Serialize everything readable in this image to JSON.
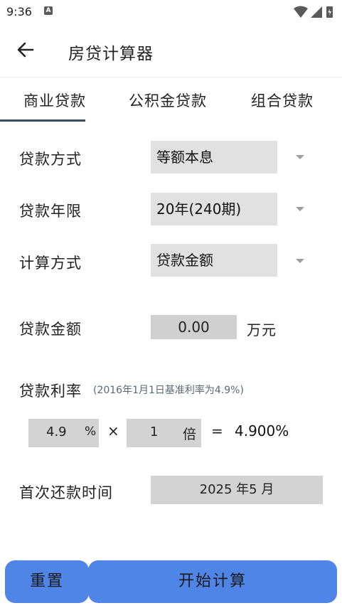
{
  "status_bar": {
    "time": "9:36",
    "notification_badge": "A"
  },
  "app_bar": {
    "title": "房贷计算器"
  },
  "tabs": [
    {
      "label": "商业贷款",
      "selected": true
    },
    {
      "label": "公积金贷款",
      "selected": false
    },
    {
      "label": "组合贷款",
      "selected": false
    }
  ],
  "form": {
    "loan_method": {
      "label": "贷款方式",
      "value": "等额本息"
    },
    "loan_term": {
      "label": "贷款年限",
      "value": "20年(240期)"
    },
    "calc_method": {
      "label": "计算方式",
      "value": "贷款金额"
    },
    "loan_amount": {
      "label": "贷款金额",
      "value": "0.00",
      "unit": "万元"
    },
    "loan_rate": {
      "label": "贷款利率",
      "note": "(2016年1月1日基准利率为4.9%)",
      "base_value": "4.9",
      "base_unit": "%",
      "multiply_sign": "×",
      "multiplier_value": "1",
      "multiplier_unit": "倍",
      "equals_sign": "=",
      "result": "4.900%"
    },
    "first_payment": {
      "label": "首次还款时间",
      "value": "2025 年5 月"
    }
  },
  "buttons": {
    "reset_label": "重置",
    "calculate_label": "开始计算"
  },
  "colors": {
    "accent": "#5085e8",
    "tab_indicator": "#3b5068",
    "select_bg": "#e1e1e1",
    "field_bg": "#d0d0d0"
  }
}
